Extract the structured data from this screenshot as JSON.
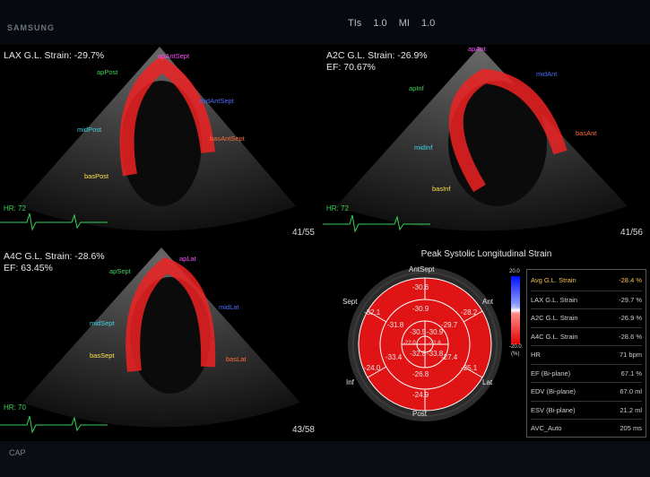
{
  "header": {
    "brand": "SAMSUNG",
    "tis_label": "TIs",
    "tis_value": "1.0",
    "mi_label": "MI",
    "mi_value": "1.0"
  },
  "lax": {
    "title": "LAX G.L. Strain: -29.7%",
    "hr": "HR: 72",
    "frame": "41/55",
    "segments": {
      "ap": "apAntSept",
      "mid": "midAntSept",
      "bas": "basAntSept",
      "apP": "apPost",
      "midP": "midPost",
      "basP": "basPost"
    }
  },
  "a2c": {
    "title": "A2C G.L. Strain: -26.9%",
    "ef": "EF: 70.67%",
    "hr": "HR: 72",
    "frame": "41/56",
    "segments": {
      "ap": "apAnt",
      "mid": "midAnt",
      "bas": "basAnt",
      "apI": "apInf",
      "midI": "midInf",
      "basI": "basInf"
    }
  },
  "a4c": {
    "title": "A4C G.L. Strain: -28.6%",
    "ef": "EF: 63.45%",
    "hr": "HR: 70",
    "frame": "43/58",
    "segments": {
      "apS": "apSept",
      "midS": "midSept",
      "basS": "basSept",
      "ap": "apLat",
      "mid": "midLat",
      "bas": "basLat"
    }
  },
  "bullseye": {
    "title": "Peak Systolic Longitudinal Strain",
    "walls": {
      "top": "AntSept",
      "right_top": "Ant",
      "right_bottom": "Lat",
      "bottom": "Post",
      "left_bottom": "Inf",
      "left_top": "Sept"
    },
    "values": {
      "o1": "-30.6",
      "o2": "-28.2",
      "o3": "-25.1",
      "o4": "-24.9",
      "o5": "-24.0",
      "o6": "-32.1",
      "m1": "-30.9",
      "m2": "-29.7",
      "m3": "-27.4",
      "m4": "-26.8",
      "m5": "-33.4",
      "m6": "-31.8",
      "a1": "-30.5",
      "a2": "-30.9",
      "a3": "-33.8",
      "a4": "-32.8",
      "c": "-22.0",
      "c2": "-21.6"
    },
    "scale": {
      "top": "20.0",
      "zero": "0",
      "bottom": "-20.0",
      "unit": "(%)"
    }
  },
  "stats": [
    {
      "k": "Avg G.L. Strain",
      "v": "-28.4 %"
    },
    {
      "k": "LAX G.L. Strain",
      "v": "-29.7 %"
    },
    {
      "k": "A2C G.L. Strain",
      "v": "-26.9 %"
    },
    {
      "k": "A4C G.L. Strain",
      "v": "-28.6 %"
    },
    {
      "k": "HR",
      "v": "71 bpm"
    },
    {
      "k": "EF (Bi-plane)",
      "v": "67.1 %"
    },
    {
      "k": "EDV (Bi-plane)",
      "v": "67.0 ml"
    },
    {
      "k": "ESV (Bi-plane)",
      "v": "21.2 ml"
    },
    {
      "k": "AVC_Auto",
      "v": "205 ms"
    }
  ],
  "footer": {
    "label": "CAP"
  },
  "colors": {
    "strain_red": "#e01414",
    "accent_yellow": "#f3c24d",
    "ecg_green": "#35d35a"
  }
}
